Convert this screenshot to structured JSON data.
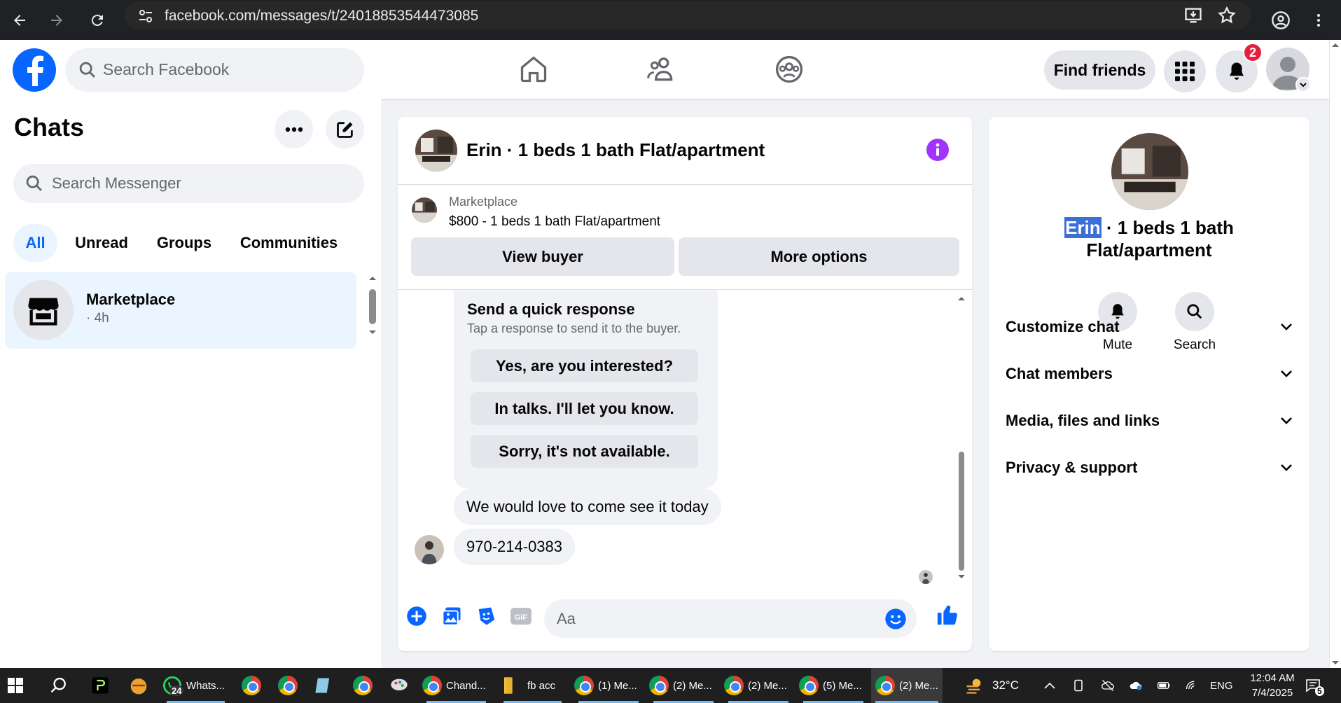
{
  "browser": {
    "url": "facebook.com/messages/t/24018853544473085"
  },
  "header": {
    "search_placeholder": "Search Facebook",
    "find_friends": "Find friends",
    "notification_count": "2"
  },
  "sidebar": {
    "title": "Chats",
    "search_placeholder": "Search Messenger",
    "filters": [
      "All",
      "Unread",
      "Groups",
      "Communities"
    ],
    "active_filter": "All",
    "chats": [
      {
        "name": "Marketplace",
        "time": "· 4h"
      }
    ]
  },
  "chat": {
    "title": "Erin · 1 beds 1 bath Flat/apartment",
    "marketplace_label": "Marketplace",
    "listing": "$800 - 1 beds 1 bath Flat/apartment",
    "view_buyer": "View buyer",
    "more_options": "More options",
    "quick_response": {
      "title": "Send a quick response",
      "subtitle": "Tap a response to send it to the buyer.",
      "options": [
        "Yes, are you interested?",
        "In talks. I'll let you know.",
        "Sorry, it's not available."
      ]
    },
    "messages": [
      {
        "text": "We would love to come see it today"
      },
      {
        "text": "970-214-0383"
      }
    ],
    "input_placeholder": "Aa"
  },
  "details": {
    "name_highlight": "Erin",
    "title_rest_line1": " · 1 beds 1 bath",
    "title_line2": "Flat/apartment",
    "mute": "Mute",
    "search": "Search",
    "sections": [
      "Customize chat",
      "Chat members",
      "Media, files and links",
      "Privacy & support"
    ]
  },
  "taskbar": {
    "apps": [
      {
        "label": "Whats...",
        "badge": "24"
      },
      {
        "label": "Chand..."
      },
      {
        "label": "fb acc"
      },
      {
        "label": "(1) Me..."
      },
      {
        "label": "(2) Me..."
      },
      {
        "label": "(2) Me..."
      },
      {
        "label": "(5) Me..."
      },
      {
        "label": "(2) Me..."
      }
    ],
    "weather": "32°C",
    "language": "ENG",
    "time": "12:04 AM",
    "date": "7/4/2025",
    "notif_count": "5"
  },
  "colors": {
    "fb_blue": "#0866ff",
    "info_purple": "#a033ff",
    "badge_red": "#e41e3f"
  }
}
